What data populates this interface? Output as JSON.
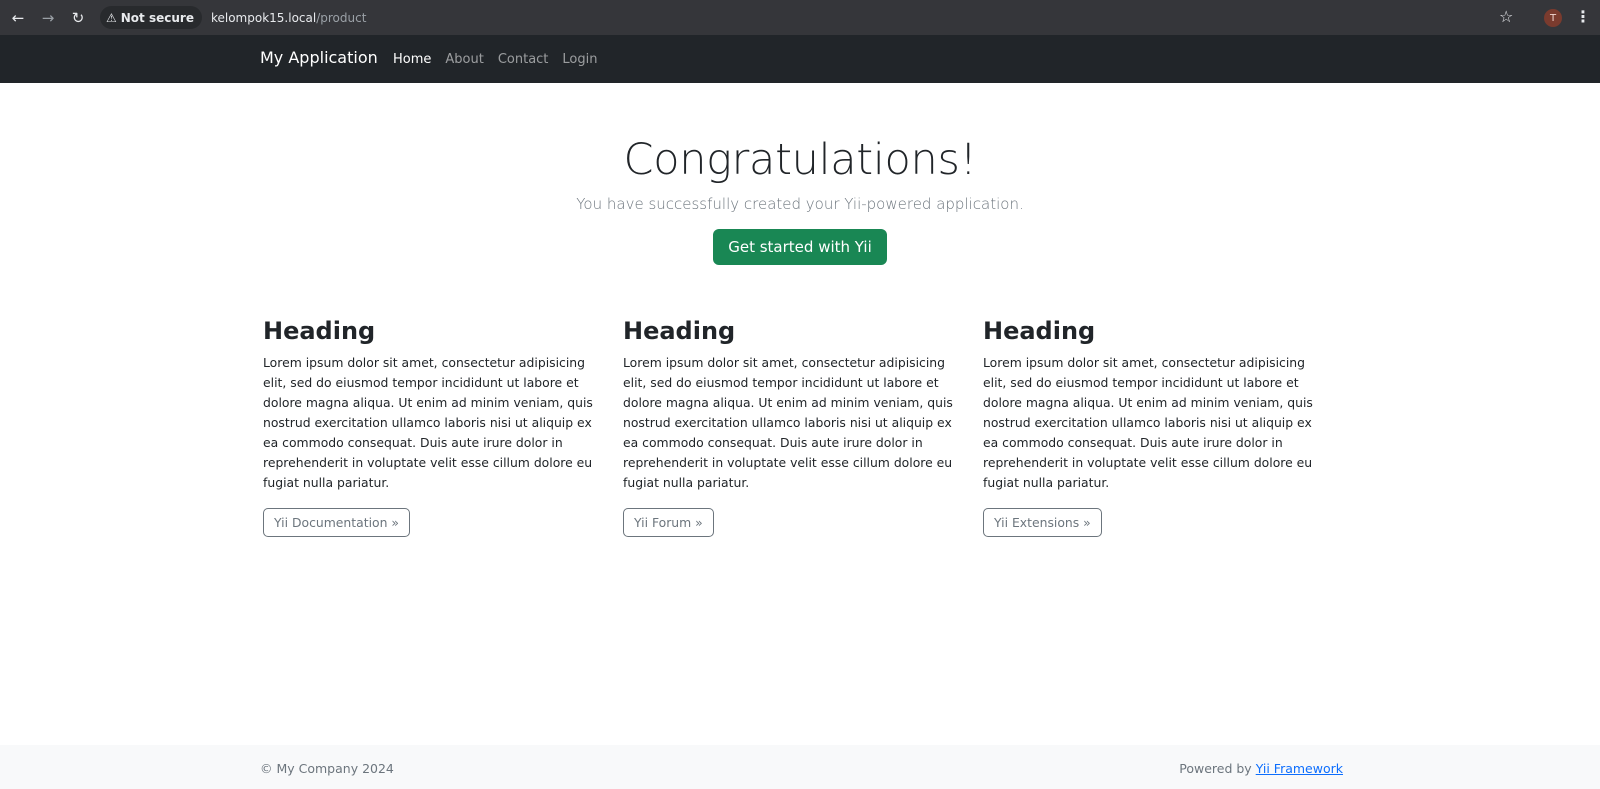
{
  "browser": {
    "back_icon": "←",
    "forward_icon": "→",
    "reload_icon": "↻",
    "security_label": "Not secure",
    "url_host": "kelompok15.local",
    "url_path": "/product",
    "profile_initial": "T"
  },
  "navbar": {
    "brand": "My Application",
    "links": [
      {
        "label": "Home"
      },
      {
        "label": "About"
      },
      {
        "label": "Contact"
      },
      {
        "label": "Login"
      }
    ]
  },
  "jumbotron": {
    "title": "Congratulations!",
    "lead": "You have successfully created your Yii-powered application.",
    "button_label": "Get started with Yii"
  },
  "columns": [
    {
      "heading": "Heading",
      "text": "Lorem ipsum dolor sit amet, consectetur adipisicing elit, sed do eiusmod tempor incididunt ut labore et dolore magna aliqua. Ut enim ad minim veniam, quis nostrud exercitation ullamco laboris nisi ut aliquip ex ea commodo consequat. Duis aute irure dolor in reprehenderit in voluptate velit esse cillum dolore eu fugiat nulla pariatur.",
      "button_label": "Yii Documentation »"
    },
    {
      "heading": "Heading",
      "text": "Lorem ipsum dolor sit amet, consectetur adipisicing elit, sed do eiusmod tempor incididunt ut labore et dolore magna aliqua. Ut enim ad minim veniam, quis nostrud exercitation ullamco laboris nisi ut aliquip ex ea commodo consequat. Duis aute irure dolor in reprehenderit in voluptate velit esse cillum dolore eu fugiat nulla pariatur.",
      "button_label": "Yii Forum »"
    },
    {
      "heading": "Heading",
      "text": "Lorem ipsum dolor sit amet, consectetur adipisicing elit, sed do eiusmod tempor incididunt ut labore et dolore magna aliqua. Ut enim ad minim veniam, quis nostrud exercitation ullamco laboris nisi ut aliquip ex ea commodo consequat. Duis aute irure dolor in reprehenderit in voluptate velit esse cillum dolore eu fugiat nulla pariatur.",
      "button_label": "Yii Extensions »"
    }
  ],
  "footer": {
    "copyright": "© My Company 2024",
    "powered_prefix": "Powered by ",
    "powered_link": "Yii Framework"
  },
  "colors": {
    "navbar_bg": "#212529",
    "success": "#198754",
    "footer_bg": "#f8f9fa",
    "link": "#0d6efd"
  }
}
